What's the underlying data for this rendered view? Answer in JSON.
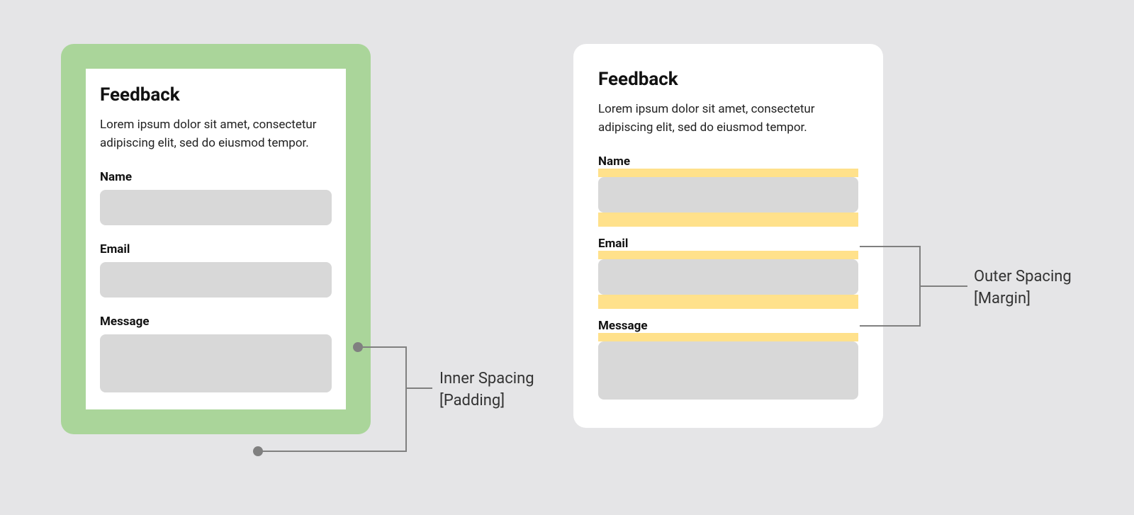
{
  "left": {
    "title": "Feedback",
    "desc": "Lorem ipsum dolor sit amet, consectetur adipiscing elit, sed  do eiusmod tempor.",
    "fields": {
      "name": "Name",
      "email": "Email",
      "message": "Message"
    }
  },
  "right": {
    "title": "Feedback",
    "desc": "Lorem ipsum dolor sit amet, consectetur adipiscing elit, sed  do eiusmod tempor.",
    "fields": {
      "name": "Name",
      "email": "Email",
      "message": "Message"
    }
  },
  "anno": {
    "left_line1": "Inner Spacing",
    "left_line2": "[Padding]",
    "right_line1": "Outer Spacing",
    "right_line2": "[Margin]"
  },
  "colors": {
    "padding_highlight": "#aad59a",
    "margin_highlight": "#ffe18b",
    "input_fill": "#d8d8d8",
    "connector": "#808080",
    "bg": "#e5e5e7"
  }
}
